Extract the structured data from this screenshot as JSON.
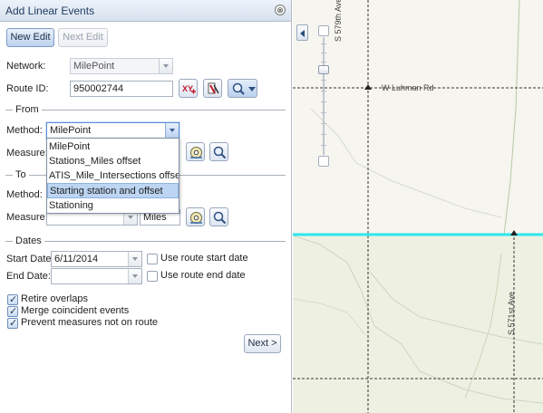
{
  "panel": {
    "title": "Add Linear Events",
    "close_glyph": "⊗",
    "new_edit_label": "New Edit",
    "next_edit_label": "Next Edit",
    "network_label": "Network:",
    "network_value": "MilePoint",
    "route_id_label": "Route ID:",
    "route_id_value": "950002744",
    "xy_icon_text": "XY"
  },
  "from": {
    "section_label": "From",
    "method_label": "Method:",
    "method_value": "MilePoint",
    "measure_label": "Measure:"
  },
  "method_options": [
    "MilePoint",
    "Stations_Miles offset",
    "ATIS_Mile_Intersections offset",
    "Starting station and offset",
    "Stationing"
  ],
  "to": {
    "section_label": "To",
    "method_label": "Method:",
    "measure_label": "Measure:",
    "units_value": "Miles"
  },
  "dates": {
    "section_label": "Dates",
    "start_label": "Start Date:",
    "start_value": "6/11/2014",
    "use_route_start_label": "Use route start date",
    "end_label": "End Date:",
    "end_value": "",
    "use_route_end_label": "Use route end date"
  },
  "options": {
    "retire_overlaps": "Retire overlaps",
    "merge_coincident": "Merge coincident events",
    "prevent_measures": "Prevent measures not on route"
  },
  "next_label": "Next >",
  "map": {
    "road_top": "S 579th Ave",
    "road_cross": "W Luhman Rd",
    "road_bottom": "S 571st Ave"
  },
  "colors": {
    "highlight_route": "#2ee6ef",
    "selected_option": "#bcd5f3"
  },
  "icons": [
    "close-icon",
    "xy-icon",
    "route-icon",
    "zoom-icon",
    "flag-icon",
    "search-icon",
    "collapse-icon"
  ]
}
